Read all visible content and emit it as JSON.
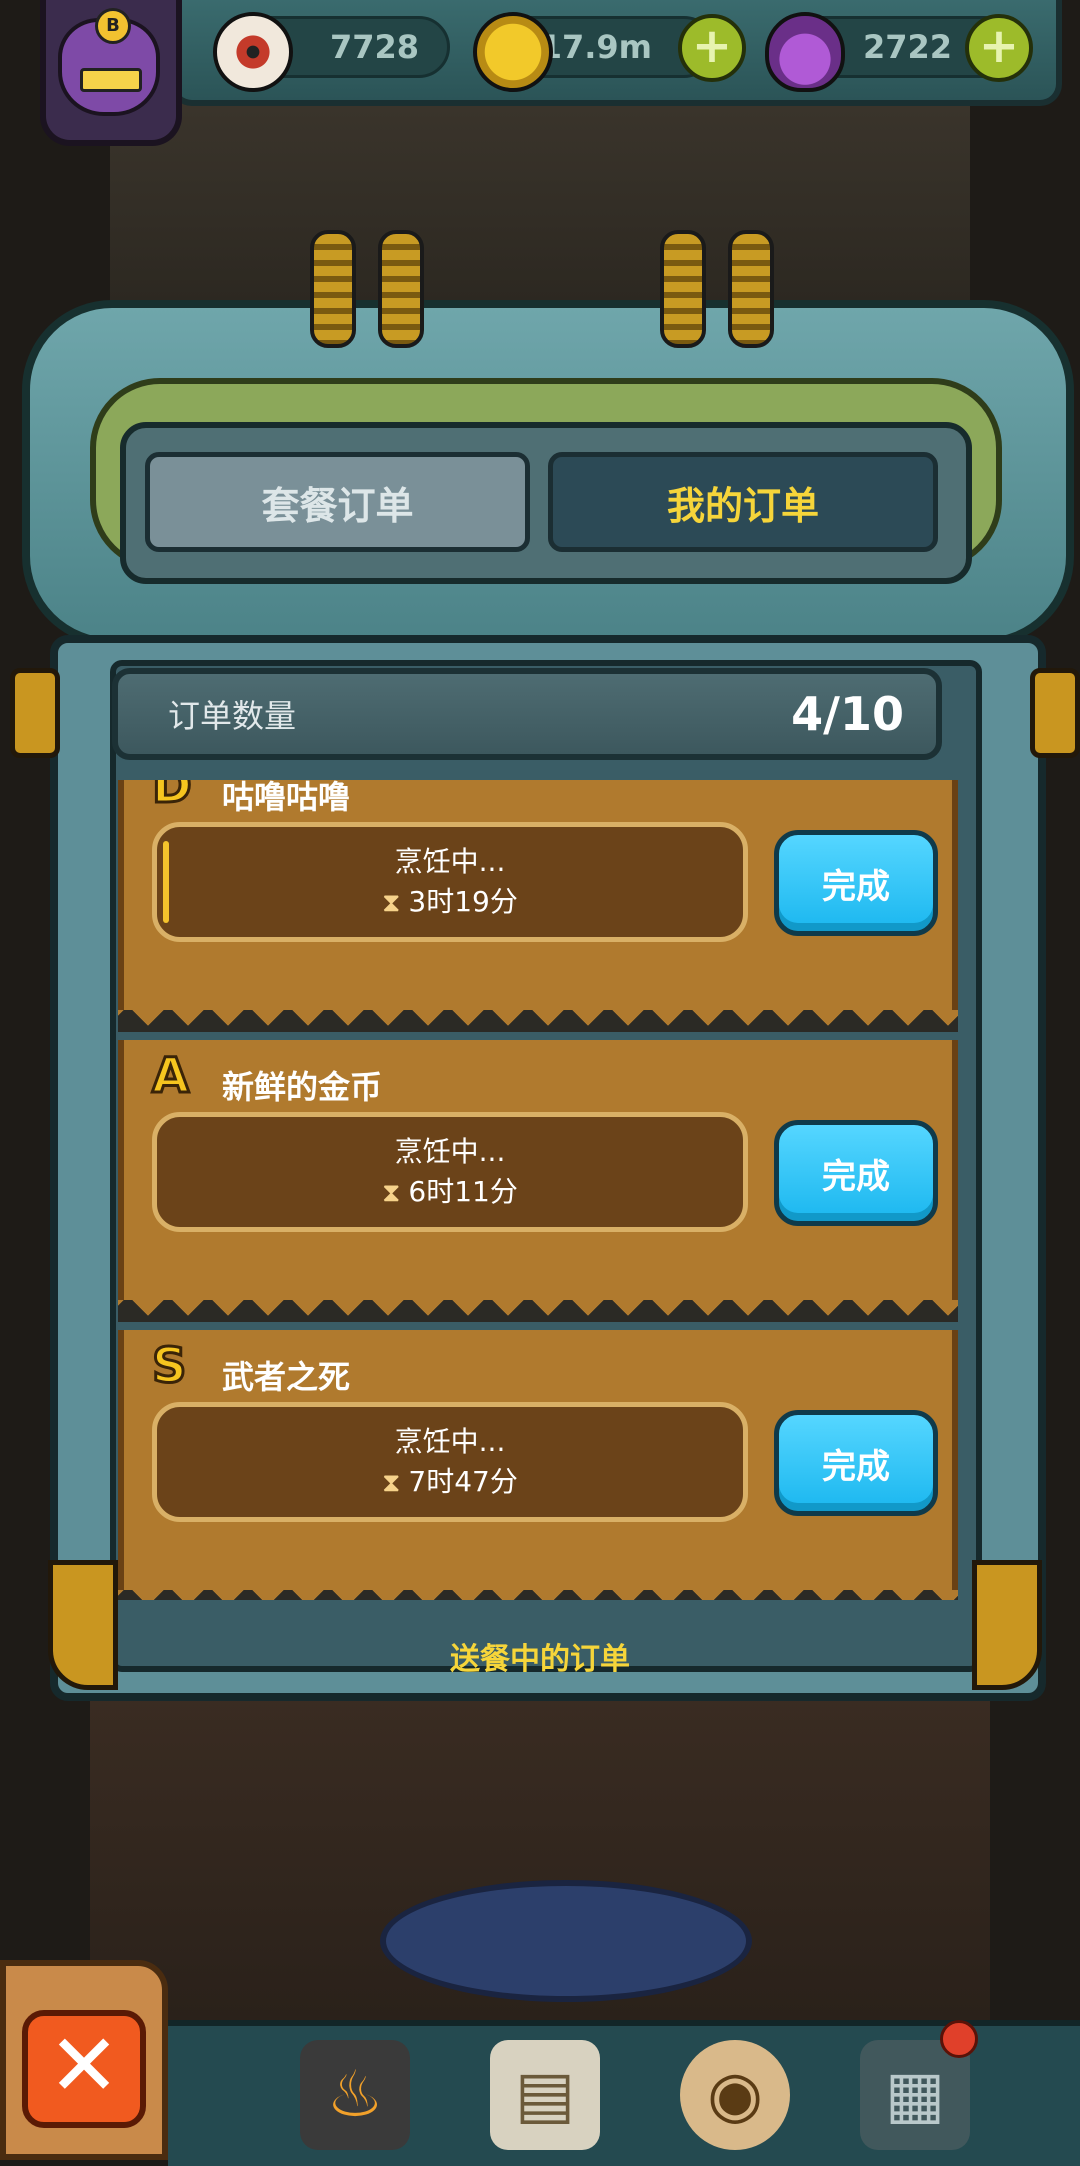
{
  "resources": [
    {
      "name": "eyeball-icon",
      "value": "7728"
    },
    {
      "name": "coin-icon",
      "value": "17.9m"
    },
    {
      "name": "potion-icon",
      "value": "2722"
    }
  ],
  "avatar": {
    "badge": "B"
  },
  "tabs": [
    {
      "label": "套餐订单",
      "active": false
    },
    {
      "label": "我的订单",
      "active": true
    }
  ],
  "order_count": {
    "label": "订单数量",
    "value": "4/10"
  },
  "orders": [
    {
      "rank": "D",
      "title": "咕噜咕噜",
      "status": "烹饪中...",
      "time": "3时19分",
      "button": "完成",
      "progress": 0.01
    },
    {
      "rank": "A",
      "title": "新鲜的金币",
      "status": "烹饪中...",
      "time": "6时11分",
      "button": "完成",
      "progress": 0.0
    },
    {
      "rank": "S",
      "title": "武者之死",
      "status": "烹饪中...",
      "time": "7时47分",
      "button": "完成",
      "progress": 0.0
    }
  ],
  "footer_note": "送餐中的订单",
  "close_label": "✕",
  "colors": {
    "accent": "#f6d53a",
    "button": "#1bb7ef",
    "card": "#b07a2e"
  }
}
